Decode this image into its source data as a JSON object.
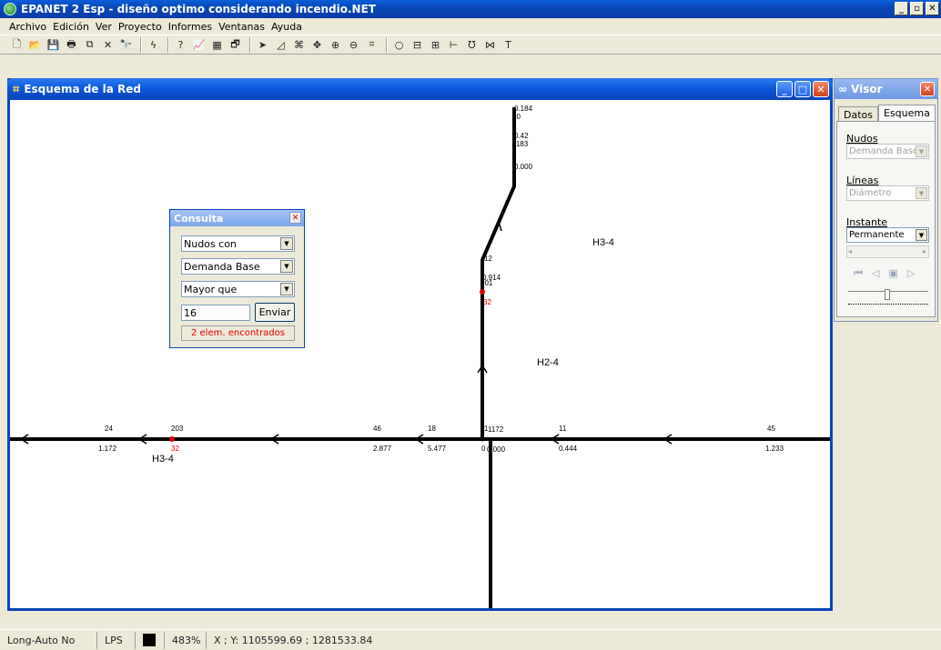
{
  "app": {
    "title": "EPANET 2 Esp - diseño optimo considerando incendio.NET"
  },
  "window_buttons": {
    "minimize": "_",
    "maximize": "▫",
    "close": "✕"
  },
  "menu": [
    "Archivo",
    "Edición",
    "Ver",
    "Proyecto",
    "Informes",
    "Ventanas",
    "Ayuda"
  ],
  "toolbar": {
    "icons": [
      "new-icon",
      "open-icon",
      "save-icon",
      "print-icon",
      "copy-icon",
      "delete-icon",
      "find-icon",
      "run-icon",
      "query-icon",
      "graph-icon",
      "table-icon",
      "options-icon",
      "select-icon",
      "select-vertex-icon",
      "select-region-icon",
      "pan-icon",
      "zoom-in-icon",
      "zoom-out-icon",
      "full-extent-icon",
      "junction-icon",
      "reservoir-icon",
      "tank-icon",
      "pipe-icon",
      "pump-icon",
      "valve-icon",
      "label-icon"
    ],
    "glyphs": [
      "🗋",
      "📂",
      "💾",
      "🖶",
      "⧉",
      "✕",
      "🔭",
      "ϟ",
      "?",
      "📈",
      "▦",
      "🗗",
      "➤",
      "◿",
      "⌘",
      "✥",
      "⊕",
      "⊖",
      "⌗",
      "○",
      "⊟",
      "⊞",
      "⊢",
      "℧",
      "⋈",
      "T"
    ]
  },
  "network_window": {
    "title": "Esquema de la Red"
  },
  "network": {
    "labels": {
      "n184": "0.184",
      "n20": "20",
      "n042": "0.42",
      "n1183": "1183",
      "n0000top": "0.000",
      "h34_upper": "H3-4",
      "n12": "12",
      "n914": "0.914",
      "n201": "201",
      "n32_upper": "32",
      "h24": "H2-4",
      "n24": "24",
      "n203": "203",
      "n46": "46",
      "n18": "18",
      "n11a": "11",
      "n1172": "1172",
      "n11b": "11",
      "n45": "45",
      "v1172": "1.172",
      "n32_lower": "32",
      "v2877": "2.877",
      "v5477": "5.477",
      "v0000": "0.000",
      "v0": "0",
      "v0444": "0.444",
      "v1233": "1.233",
      "h34_lower": "H3-4"
    },
    "colors": {
      "pipe": "#000000",
      "highlight_node": "#e00000",
      "highlight_text": "#e00000"
    }
  },
  "consulta": {
    "title": "Consulta",
    "select1": "Nudos con",
    "select2": "Demanda Base",
    "select3": "Mayor que",
    "value": "16",
    "submit": "Enviar",
    "status": "2 elem. encontrados"
  },
  "visor": {
    "title": "Visor",
    "tabs": [
      "Datos",
      "Esquema"
    ],
    "nudos_label": "Nudos",
    "nudos_value": "Demanda Base",
    "lineas_label": "Líneas",
    "lineas_value": "Diámetro",
    "instante_label": "Instante",
    "instante_value": "Permanente"
  },
  "status": {
    "autolength": "Long-Auto No",
    "units": "LPS",
    "zoom": "483%",
    "coords": "X ; Y: 1105599.69 ; 1281533.84"
  }
}
